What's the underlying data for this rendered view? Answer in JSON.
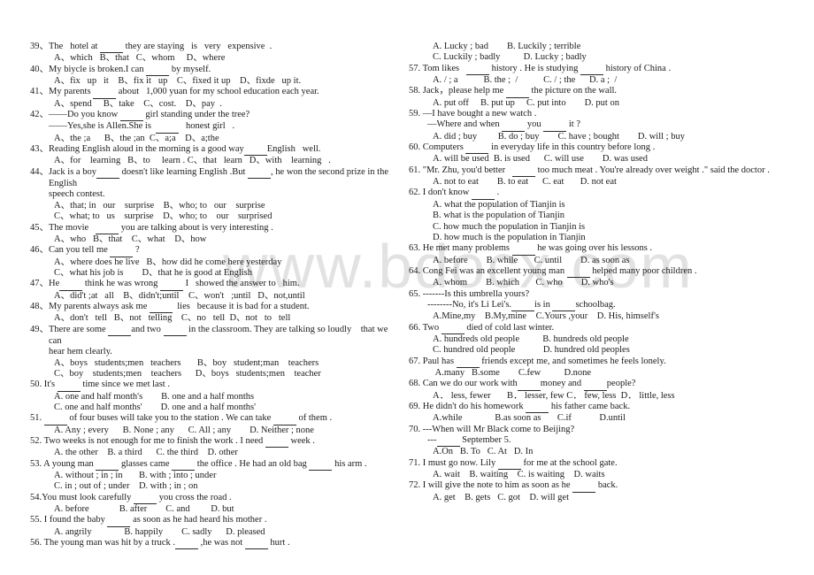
{
  "document": {
    "watermark": "www.bdocx.com",
    "title": "English Grammar Multiple Choice Questions 39-72"
  },
  "left_column": [
    {
      "number": "39、",
      "stem": "The   hotel at ____ they are staying   is   very   expensive  .",
      "options": [
        "A、which   B、that   C、whom     D、where"
      ]
    },
    {
      "number": "40、",
      "stem": "My biycle is broken.I can ____ by myself.",
      "options": [
        "A、fix   up   it    B、fix it   up    C、fixed it up    D、fixde   up it."
      ]
    },
    {
      "number": "41、",
      "stem": "My parents ____ about   1,000 yuan for my school education each year.",
      "options": [
        "A、spend     B、take    C、cost.    D、pay  ."
      ]
    },
    {
      "number": "42、",
      "stem": "——Do you know ____ girl standing under the tree?",
      "cont": "——Yes,she is Allen.She is  ____   honest girl   .",
      "options": [
        "A、the ;a      B、the ;an  C、a;a    D、a;the"
      ]
    },
    {
      "number": "43、",
      "stem": "Reading English aloud in the morning is a good way____English   well.",
      "options": [
        "A、for    learning   B、to     learn . C、that   learn   D、with    learning   ."
      ]
    },
    {
      "number": "44、",
      "stem": "Jack is a boy____ doesn't like learning English .But ____, he won the second prize in the English",
      "cont": "speech contest.",
      "options": [
        "A、that; in   our    surprise    B、who; to   our    surprise",
        "C、what; to   us    surprise    D、who; to    our    surprised"
      ]
    },
    {
      "number": "45、",
      "stem": "The movie   ____ you are talking about is very interesting .",
      "options": [
        "A、who   B、that    C、what    D、how"
      ]
    },
    {
      "number": "46、",
      "stem": "Can you tell me ____ ?",
      "options": [
        "A、where does he live   B、how did he come here yesterday",
        "C、what his job is        D、that he is good at English"
      ]
    },
    {
      "number": "47、",
      "stem": "He____ think he was wrong ____ I   showed the answer to   him.",
      "options": [
        "A、did't ;at   all    B、didn't;until    C、won't   ;until   D、not,until"
      ]
    },
    {
      "number": "48、",
      "stem": "My parents always ask me ____  lies   because it is bad for a student.",
      "options": [
        "A、don't   tell   B、not   telling    C、no   tell  D、not   to   tell"
      ]
    },
    {
      "number": "49、",
      "stem": "There are some ____and two ____ in the classroom. They are talking so loudly    that we can",
      "cont": "hear hem clearly.",
      "options": [
        "A、boys   students;men   teachers       B、boy   student;man    teachers",
        "C、boy    students;men    teachers      D、boys   students;men    teacher"
      ]
    },
    {
      "number": "50. ",
      "stem": "It's ____ time since we met last .",
      "options": [
        "A. one and half month's        B. one and a half months",
        "C. one and half months'        D. one and a half months'"
      ]
    },
    {
      "number": "51. ",
      "stem": "____ of four buses will take you to the station . We can take ____ of them .",
      "options": [
        "A. Any ; every      B. None ; any      C. All ; any        D. Neither ; none"
      ]
    },
    {
      "number": "52. ",
      "stem": "Two weeks is not enough for me to finish the work . I need ____ week .",
      "options": [
        "A. the other    B. a third      C. the third    D. other"
      ]
    },
    {
      "number": "53. ",
      "stem": "A young man ____ glasses came ____ the office . He had an old bag ____ his arm .",
      "options": [
        "A. without ; in ; in       B. with ; into ; under",
        "C. in ; out of ; under    D. with ; in ; on"
      ]
    },
    {
      "number": "54.",
      "stem": "You must look carefully ____ you cross the road .",
      "options": [
        "A. before             B. after        C. and         D. but"
      ]
    },
    {
      "number": "55. ",
      "stem": "I found the baby ____ as soon as he had heard his mother .",
      "options": [
        "A. angrily              B. happily        C. sadly      D. pleased"
      ]
    },
    {
      "number": "56. ",
      "stem": "The young man was hit by a truck .____ ,he was not ____ hurt .",
      "options": []
    }
  ],
  "right_column": [
    {
      "number": "",
      "stem": "",
      "options": [
        "A. Lucky ; bad        B. Luckily ; terrible",
        "C. Luckily ; badly          D. Lucky ; badly"
      ]
    },
    {
      "number": "57. ",
      "stem": "Tom likes   ____ history . He is studying ____ history of China .",
      "options": [
        "A. / ; a           B. the ;  /           C. / ; the      D. a ;  /"
      ]
    },
    {
      "number": "58. ",
      "stem": "Jack，please help me ____ the picture on the wall.",
      "options": [
        "A. put off     B. put up     C. put into        D. put on"
      ]
    },
    {
      "number": "59. ",
      "stem": "—I have bought a new watch .",
      "cont": "—Where and when ____ you ____ it ?",
      "options": [
        "A. did ; buy         B. do ; buy        C. have ; bought        D. will ; buy"
      ]
    },
    {
      "number": "60. ",
      "stem": "Computers ____ in everyday life in this country before long .",
      "options": [
        "A. will be used  B. is used      C. will use        D. was used"
      ]
    },
    {
      "number": "61. ",
      "stem": "\"Mr. Zhu, you'd better   ____ too much meat . You're already over weight .\" said the doctor .",
      "options": [
        "A. not to eat        B. to eat      C. eat       D. not eat"
      ]
    },
    {
      "number": "62. ",
      "stem": "I don't know ____ .",
      "options": [
        "A. what the population of Tianjin is",
        "B. what is the population of Tianjin",
        "C. how much the population in Tianjin is",
        "D. how much is the population in Tianjin"
      ]
    },
    {
      "number": "63. ",
      "stem": "He met many problems ____ he was going over his lessons .",
      "options": [
        "A. before        B. while       C. until        D. as soon as"
      ]
    },
    {
      "number": "64. ",
      "stem": "Cong Fei was an excellent young man ____ helped many poor children .",
      "options": [
        "A. whom        B. which       C. who        D. who's"
      ]
    },
    {
      "number": "65. ",
      "stem": "-------Is this umbrella yours?",
      "cont": "--------No, it's Li Lei's.____is in ____schoolbag.",
      "options": [
        "A.Mine,my    B.My,mine    C.Yours ,your    D. His, himself's"
      ]
    },
    {
      "number": "66. ",
      "stem": "Two ____ died of cold last winter.",
      "options": [
        "A. hundreds old people          B. hundreds old people",
        "C. hundred old people            D. hundred old peoples"
      ]
    },
    {
      "number": "67. ",
      "stem": "Paul has ____ friends except me, and sometimes he feels lonely.",
      "options": [
        " A.many   B.some        C.few          D.none"
      ]
    },
    {
      "number": "68. ",
      "stem": "Can we do our work with____money and ____people?",
      "options": [
        "A． less, fewer       B． lesser, few C． few, less  D． little, less"
      ]
    },
    {
      "number": "69. ",
      "stem": "He didn't do his homework ____ his father came back.",
      "options": [
        "A.while              B.as soon as       C.if            D.until"
      ]
    },
    {
      "number": "70. ",
      "stem": "---When will Mr Black come to Beijing?",
      "cont": "---____ September 5.",
      "options": [
        "A.On   B. To   C. At   D. In"
      ]
    },
    {
      "number": "71. ",
      "stem": "I must go now. Lily ____ for me at the school gate.",
      "options": [
        "A. wait    B. waiting    C. is waiting    D. waits"
      ]
    },
    {
      "number": "72. ",
      "stem": "I will give the note to him as soon as he ____ back.",
      "options": [
        "A. get    B. gets   C. got    D. will get"
      ]
    }
  ]
}
